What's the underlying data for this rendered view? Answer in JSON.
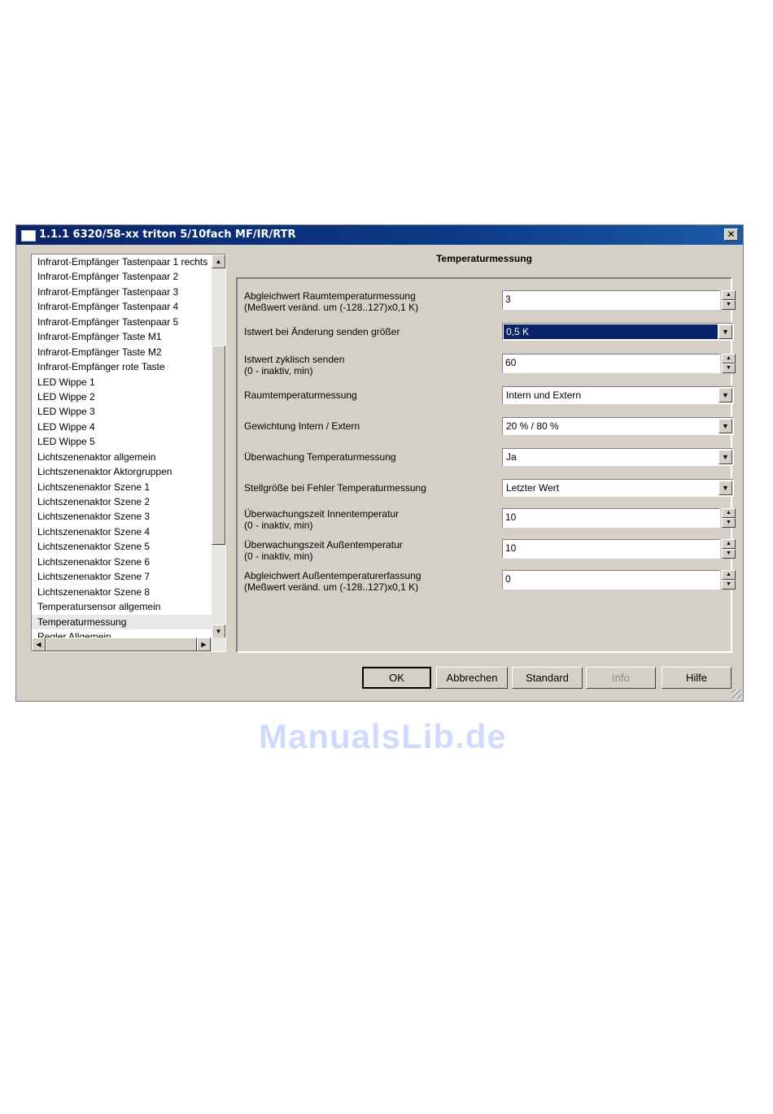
{
  "window": {
    "title": "1.1.1 6320/58-xx triton 5/10fach MF/IR/RTR",
    "close_label": "✕"
  },
  "tree": {
    "items": [
      "Infrarot-Empfänger Tastenpaar 1 rechts",
      "Infrarot-Empfänger Tastenpaar 2",
      "Infrarot-Empfänger Tastenpaar 3",
      "Infrarot-Empfänger Tastenpaar 4",
      "Infrarot-Empfänger Tastenpaar 5",
      "Infrarot-Empfänger Taste M1",
      "Infrarot-Empfänger Taste M2",
      "Infrarot-Empfänger rote Taste",
      "LED Wippe 1",
      "LED Wippe 2",
      "LED Wippe 3",
      "LED Wippe 4",
      "LED Wippe 5",
      "Lichtszenenaktor allgemein",
      "Lichtszenenaktor Aktorgruppen",
      "Lichtszenenaktor Szene 1",
      "Lichtszenenaktor Szene 2",
      "Lichtszenenaktor Szene 3",
      "Lichtszenenaktor Szene 4",
      "Lichtszenenaktor Szene 5",
      "Lichtszenenaktor Szene 6",
      "Lichtszenenaktor Szene 7",
      "Lichtszenenaktor Szene 8",
      "Temperatursensor allgemein",
      "Temperaturmessung",
      "Regler Allgemein"
    ],
    "selected_index": 24
  },
  "panel": {
    "title": "Temperaturmessung",
    "params": [
      {
        "label1": "Abgleichwert Raumtemperaturmessung",
        "label2": "(Meßwert veränd. um (-128..127)x0,1 K)",
        "type": "spin",
        "value": "3"
      },
      {
        "label1": "Istwert bei Änderung senden größer",
        "label2": "",
        "type": "combo",
        "value": "0,5 K",
        "focused": true
      },
      {
        "label1": "Istwert zyklisch senden",
        "label2": "(0 - inaktiv, min)",
        "type": "spin",
        "value": "60"
      },
      {
        "label1": "Raumtemperaturmessung",
        "label2": "",
        "type": "combo",
        "value": "Intern und Extern"
      },
      {
        "label1": "Gewichtung Intern / Extern",
        "label2": "",
        "type": "combo",
        "value": "20 % / 80 %"
      },
      {
        "label1": "Überwachung Temperaturmessung",
        "label2": "",
        "type": "combo",
        "value": "Ja"
      },
      {
        "label1": "Stellgröße bei Fehler Temperaturmessung",
        "label2": "",
        "type": "combo",
        "value": "Letzter Wert"
      },
      {
        "label1": "Überwachungszeit Innentemperatur",
        "label2": "(0 - inaktiv, min)",
        "type": "spin",
        "value": "10"
      },
      {
        "label1": "Überwachungszeit Außentemperatur",
        "label2": "(0 - inaktiv, min)",
        "type": "spin",
        "value": "10"
      },
      {
        "label1": "Abgleichwert Außentemperaturerfassung",
        "label2": "(Meßwert veränd. um (-128..127)x0,1 K)",
        "type": "spin",
        "value": "0"
      }
    ]
  },
  "buttons": {
    "ok": "OK",
    "cancel": "Abbrechen",
    "standard": "Standard",
    "info": "Info",
    "help": "Hilfe"
  },
  "watermark": "ManualsLib.de",
  "colors": {
    "titlebar": "#0a246a",
    "selection": "#0a246a",
    "face": "#d4d0c8"
  }
}
